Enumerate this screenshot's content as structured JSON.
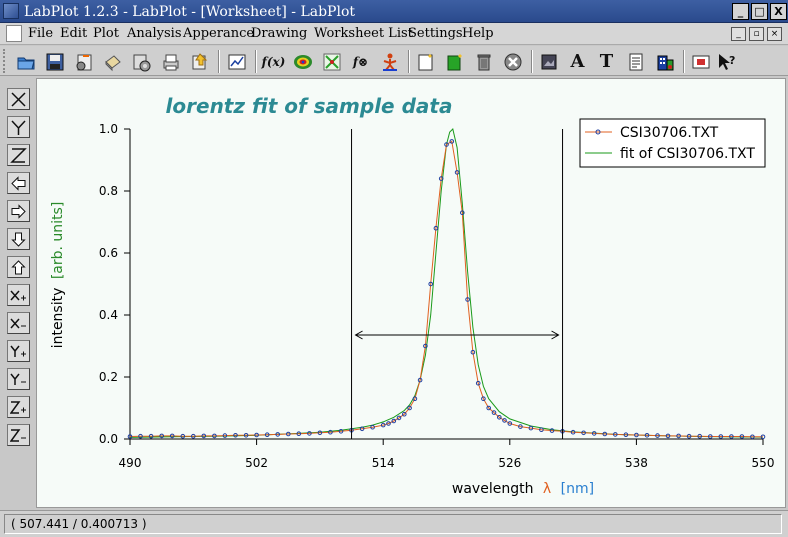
{
  "window": {
    "title": "LabPlot 1.2.3 - LabPlot - [Worksheet] - LabPlot",
    "minimize_label": "_",
    "maximize_label": "□",
    "close_label": "X"
  },
  "menubar": {
    "items": [
      "File",
      "Edit",
      "Plot",
      "Analysis",
      "Apperance",
      "Drawing",
      "Worksheet List",
      "Settings",
      "Help"
    ]
  },
  "toolbar": {
    "buttons": [
      "open-icon",
      "save-icon",
      "import-icon",
      "print-icon",
      "settings-icon",
      "print-preview-icon",
      "export-icon",
      "graph-icon",
      "function-icon",
      "surface-icon",
      "scatter-icon",
      "function-3d-icon",
      "figure-icon",
      "new-worksheet-icon",
      "new-spreadsheet-icon",
      "trash-icon",
      "close-circle-icon",
      "image-icon",
      "text-A-icon",
      "text-T-icon",
      "notes-icon",
      "building-icon",
      "fit-screen-icon",
      "whats-this-icon"
    ],
    "text_A": "A",
    "text_T": "T",
    "fx": "f(x)"
  },
  "left_toolbar": {
    "buttons": [
      "x-icon",
      "y-icon",
      "z-icon",
      "arrow-left-icon",
      "arrow-right-icon",
      "arrow-down-icon",
      "arrow-up-icon",
      "x-plus-icon",
      "x-minus-icon",
      "y-plus-icon",
      "y-minus-icon",
      "z-plus-icon",
      "z-minus-icon"
    ]
  },
  "chart_data": {
    "type": "line",
    "title": "lorentz fit of sample data",
    "xlabel": "wavelength",
    "xlabel_symbol": "λ",
    "xlabel_unit": "[nm]",
    "ylabel": "intensity",
    "ylabel_unit": "[arb. units]",
    "xlim": [
      490,
      550
    ],
    "ylim": [
      0,
      1
    ],
    "x_ticks": [
      490,
      502,
      514,
      526,
      538,
      550
    ],
    "y_ticks": [
      0.0,
      0.2,
      0.4,
      0.6,
      0.8,
      1.0
    ],
    "y_tick_labels": [
      "0.0",
      "0.2",
      "0.4",
      "0.6",
      "0.8",
      "1.0"
    ],
    "grid": false,
    "legend_position": "top-right",
    "markers": [
      511,
      531
    ],
    "width_arrow_y": 0.5,
    "series": [
      {
        "name": "CSI30706.TXT",
        "color": "#e06020",
        "marker_color": "#1f3fa0",
        "x": [
          490,
          491,
          492,
          493,
          494,
          495,
          496,
          497,
          498,
          499,
          500,
          501,
          502,
          503,
          504,
          505,
          506,
          507,
          508,
          509,
          510,
          511,
          512,
          513,
          514,
          514.5,
          515,
          515.5,
          516,
          516.5,
          517,
          517.5,
          518,
          518.5,
          519,
          519.5,
          520,
          520.5,
          521,
          521.5,
          522,
          522.5,
          523,
          523.5,
          524,
          524.5,
          525,
          525.5,
          526,
          527,
          528,
          529,
          530,
          531,
          532,
          533,
          534,
          535,
          536,
          537,
          538,
          539,
          540,
          541,
          542,
          543,
          544,
          545,
          546,
          547,
          548,
          549,
          550
        ],
        "values": [
          0.008,
          0.009,
          0.009,
          0.01,
          0.01,
          0.009,
          0.009,
          0.01,
          0.01,
          0.011,
          0.012,
          0.012,
          0.013,
          0.014,
          0.015,
          0.016,
          0.017,
          0.018,
          0.02,
          0.022,
          0.025,
          0.028,
          0.033,
          0.038,
          0.045,
          0.05,
          0.058,
          0.068,
          0.08,
          0.1,
          0.13,
          0.19,
          0.3,
          0.5,
          0.68,
          0.84,
          0.95,
          0.96,
          0.86,
          0.73,
          0.45,
          0.28,
          0.18,
          0.13,
          0.1,
          0.085,
          0.07,
          0.06,
          0.05,
          0.04,
          0.035,
          0.03,
          0.027,
          0.025,
          0.022,
          0.02,
          0.018,
          0.016,
          0.015,
          0.014,
          0.013,
          0.012,
          0.011,
          0.01,
          0.01,
          0.009,
          0.009,
          0.008,
          0.008,
          0.008,
          0.008,
          0.007,
          0.007
        ]
      },
      {
        "name": "fit of CSI30706.TXT",
        "color": "#1a9a1a",
        "x": [
          490,
          494,
          498,
          502,
          506,
          508,
          510,
          512,
          513,
          514,
          515,
          516,
          516.5,
          517,
          517.5,
          518,
          518.5,
          519,
          519.5,
          520,
          520.3,
          520.6,
          521,
          521.5,
          522,
          522.5,
          523,
          523.5,
          524,
          525,
          526,
          528,
          530,
          532,
          536,
          540,
          544,
          550
        ],
        "values": [
          0.005,
          0.007,
          0.009,
          0.012,
          0.018,
          0.022,
          0.028,
          0.038,
          0.045,
          0.055,
          0.07,
          0.092,
          0.11,
          0.14,
          0.19,
          0.27,
          0.4,
          0.6,
          0.8,
          0.95,
          0.99,
          1.0,
          0.94,
          0.76,
          0.54,
          0.36,
          0.24,
          0.17,
          0.13,
          0.088,
          0.065,
          0.042,
          0.03,
          0.023,
          0.015,
          0.011,
          0.008,
          0.006
        ]
      }
    ]
  },
  "status": {
    "coordinates": "( 507.441 / 0.400713 )"
  }
}
